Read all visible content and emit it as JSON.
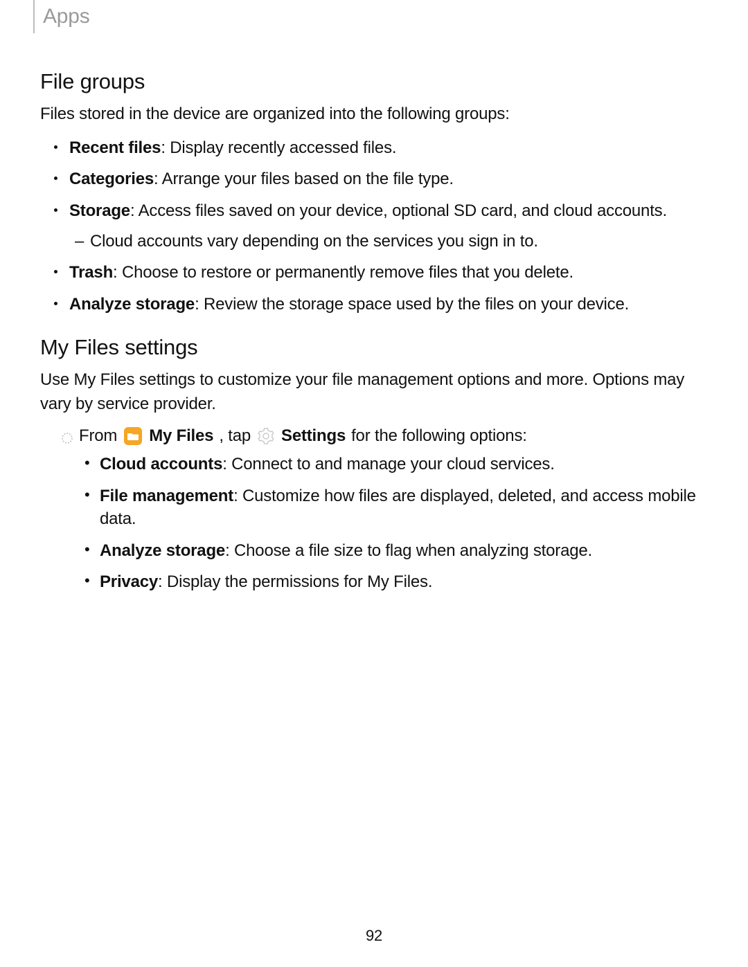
{
  "header": {
    "title": "Apps"
  },
  "section1": {
    "heading": "File groups",
    "intro": "Files stored in the device are organized into the following groups:",
    "items": [
      {
        "term": "Recent files",
        "desc": ": Display recently accessed files."
      },
      {
        "term": "Categories",
        "desc": ": Arrange your files based on the file type."
      },
      {
        "term": "Storage",
        "desc": ": Access files saved on your device, optional SD card, and cloud accounts.",
        "sub": [
          "Cloud accounts vary depending on the services you sign in to."
        ]
      },
      {
        "term": "Trash",
        "desc": ": Choose to restore or permanently remove files that you delete."
      },
      {
        "term": "Analyze storage",
        "desc": ": Review the storage space used by the files on your device."
      }
    ]
  },
  "section2": {
    "heading": "My Files settings",
    "intro": "Use My Files settings to customize your file management options and more. Options may vary by service provider.",
    "step": {
      "from": "From",
      "app": "My Files",
      "tap": ", tap",
      "settings": "Settings",
      "tail": " for the following options:"
    },
    "items": [
      {
        "term": "Cloud accounts",
        "desc": ": Connect to and manage your cloud services."
      },
      {
        "term": "File management",
        "desc": ": Customize how files are displayed, deleted, and access mobile data."
      },
      {
        "term": "Analyze storage",
        "desc": ": Choose a file size to flag when analyzing storage."
      },
      {
        "term": "Privacy",
        "desc": ": Display the permissions for My Files."
      }
    ]
  },
  "page_number": "92"
}
